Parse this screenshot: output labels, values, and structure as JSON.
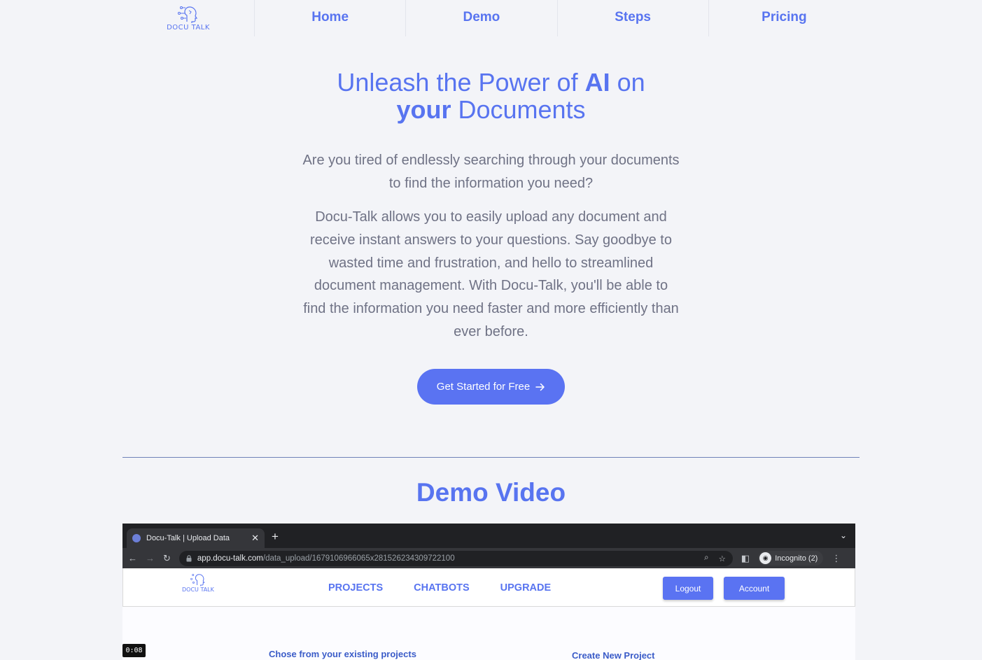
{
  "logo": {
    "text": "DOCU TALK"
  },
  "nav": {
    "items": [
      "Home",
      "Demo",
      "Steps",
      "Pricing"
    ]
  },
  "hero": {
    "title_part1": "Unleash the Power of ",
    "title_bold1": "AI",
    "title_part2": " on",
    "title_bold2": "your",
    "title_part3": " Documents",
    "subtitle": "Are you tired of endlessly searching through your documents to find the information you need?",
    "body": "Docu-Talk allows you to easily upload any document and receive instant answers to your questions. Say goodbye to wasted time and frustration, and hello to streamlined document management. With Docu-Talk, you'll be able to find the information you need faster and more efficiently than ever before.",
    "cta_label": "Get Started for Free",
    "cta_icon": "arrow-right-icon"
  },
  "demo": {
    "title": "Demo Video",
    "timestamp": "0:08",
    "browser": {
      "tab_title": "Docu-Talk | Upload Data",
      "url_host": "app.docu-talk.com",
      "url_path": "/data_upload/1679106966065x281526234309722100",
      "incognito_label": "Incognito (2)"
    },
    "app": {
      "logo_text": "DOCU TALK",
      "nav": [
        "PROJECTS",
        "CHATBOTS",
        "UPGRADE"
      ],
      "logout_label": "Logout",
      "account_label": "Account",
      "existing_projects": "Chose from your existing projects",
      "new_project": "Create New Project"
    }
  },
  "colors": {
    "accent": "#5874f0",
    "button": "#5a73f2",
    "background": "#f3f4f8",
    "text": "#6f7285"
  }
}
